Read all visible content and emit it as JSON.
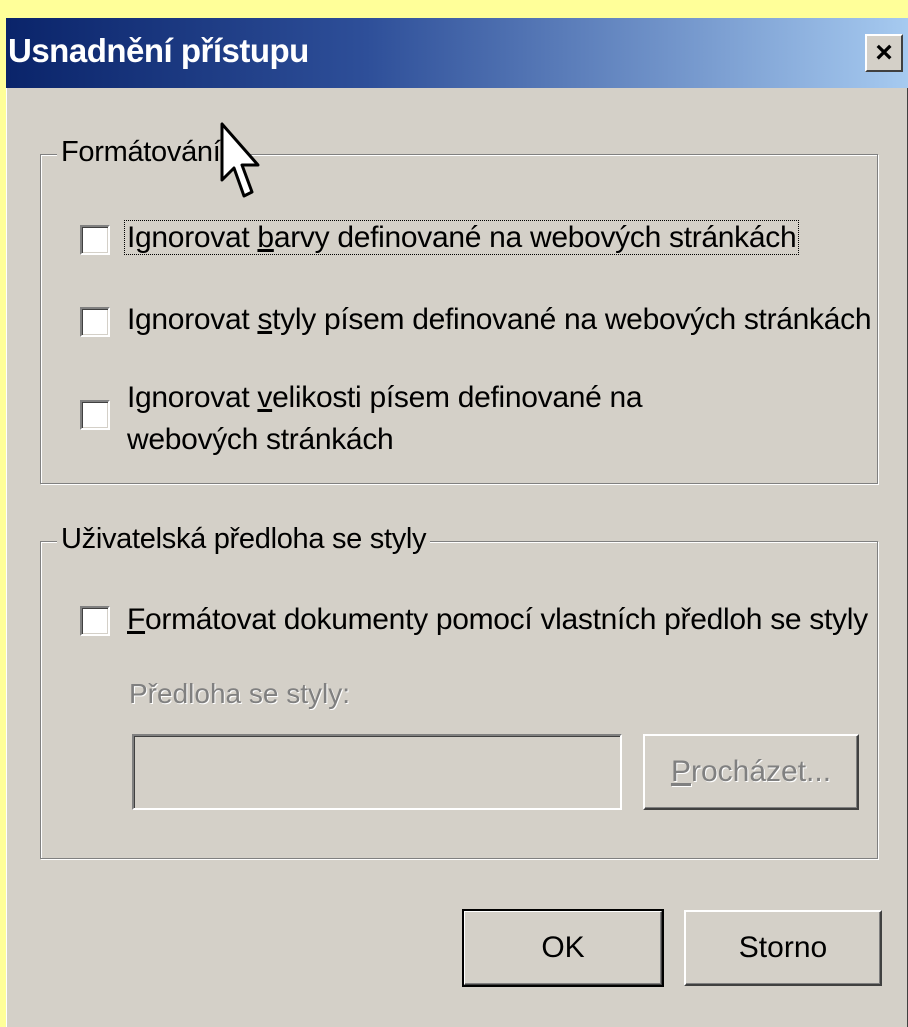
{
  "dialog": {
    "title": "Usnadnění přístupu",
    "close_glyph": "×"
  },
  "formatting": {
    "legend": "Formátování",
    "options": [
      {
        "pre": "Ignorovat ",
        "key": "b",
        "post": "arvy definované na webových stránkách",
        "checked": false,
        "focused": true
      },
      {
        "pre": "Ignorovat ",
        "key": "s",
        "post": "tyly písem definované na webových stránkách",
        "checked": false,
        "focused": false
      },
      {
        "pre": "Ignorovat ",
        "key": "v",
        "post": "elikosti písem definované na",
        "line2": "webových stránkách",
        "checked": false,
        "focused": false
      }
    ]
  },
  "stylesheet": {
    "legend": "Uživatelská předloha se styly",
    "option": {
      "pre": "",
      "key": "F",
      "post": "ormátovat dokumenty pomocí vlastních předloh se styly",
      "checked": false
    },
    "field_label": "Předloha se styly:",
    "field_value": "",
    "browse_key": "P",
    "browse_rest": "rocházet..."
  },
  "buttons": {
    "ok": "OK",
    "cancel": "Storno"
  },
  "icons": {
    "close": "close-icon",
    "cursor": "mouse-pointer-icon"
  },
  "colors": {
    "title_gradient_start": "#0a246a",
    "title_gradient_end": "#a6caf0",
    "dialog_bg": "#d4d0c8",
    "desktop_bg": "#ffff99"
  }
}
